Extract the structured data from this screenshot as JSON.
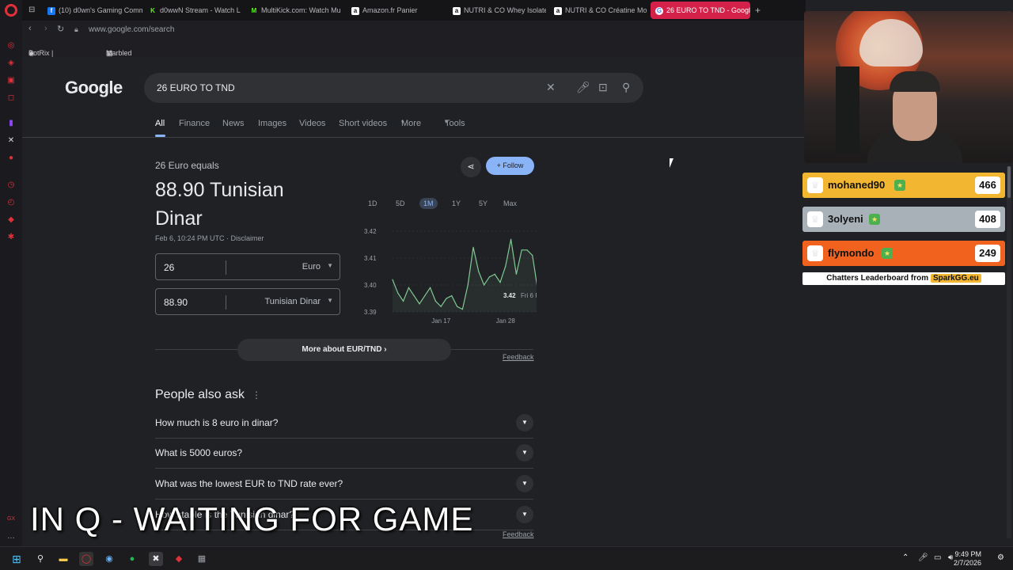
{
  "browser": {
    "tabs": [
      {
        "label": "(10) d0wn's Gaming Comm",
        "favicon": "facebook-icon",
        "color": "#1877f2"
      },
      {
        "label": "d0wwN Stream - Watch L",
        "favicon": "kick-icon",
        "color": "#53fc18"
      },
      {
        "label": "MultiKick.com: Watch Mu",
        "favicon": "multikick-icon",
        "color": "#53fc18"
      },
      {
        "label": "Amazon.fr Panier",
        "favicon": "amazon-icon",
        "color": "#ffffff"
      },
      {
        "label": "NUTRI & CO Whey Isolate",
        "favicon": "amazon-icon",
        "color": "#ffffff"
      },
      {
        "label": "NUTRI & CO Créatine Mo",
        "favicon": "amazon-icon",
        "color": "#ffffff"
      },
      {
        "label": "26 EURO TO TND - Googl",
        "favicon": "google-icon",
        "color": "#ffffff"
      }
    ],
    "url": "www.google.com/search",
    "bookmarks": [
      "BotRix | Giveaways",
      "Marbled Dashboar..."
    ]
  },
  "google": {
    "logo": "Google",
    "query": "26 EURO TO TND",
    "tabs": [
      "All",
      "Finance",
      "News",
      "Images",
      "Videos",
      "Short videos",
      "More",
      "Tools"
    ],
    "equals_text": "26 Euro equals",
    "result_line1": "88.90 Tunisian",
    "result_line2": "Dinar",
    "timestamp": "Feb 6, 10:24 PM UTC",
    "disclaimer": "Disclaimer",
    "from_value": "26",
    "from_currency": "Euro",
    "to_value": "88.90",
    "to_currency": "Tunisian Dinar",
    "follow_label": "Follow",
    "ranges": [
      "1D",
      "5D",
      "1M",
      "1Y",
      "5Y",
      "Max"
    ],
    "selected_range": "1M",
    "more_about": "More about EUR/TND",
    "feedback": "Feedback",
    "paa_title": "People also ask",
    "paa": [
      "How much is 8 euro in dinar?",
      "What is 5000 euros?",
      "What was the lowest EUR to TND rate ever?",
      "How stable is the Tunisian dinar?"
    ]
  },
  "chart_data": {
    "type": "line",
    "y_ticks": [
      "3.42",
      "3.41",
      "3.40",
      "3.39"
    ],
    "ylim": [
      3.39,
      3.42
    ],
    "x_ticks": [
      "Jan 17",
      "Jan 28"
    ],
    "values": [
      3.402,
      3.397,
      3.394,
      3.399,
      3.396,
      3.393,
      3.396,
      3.399,
      3.394,
      3.392,
      3.395,
      3.396,
      3.392,
      3.391,
      3.4,
      3.414,
      3.405,
      3.4,
      3.403,
      3.404,
      3.401,
      3.407,
      3.417,
      3.404,
      3.413,
      3.413,
      3.411,
      3.398,
      3.409,
      3.417,
      3.42
    ],
    "tooltip_value": "3.42",
    "tooltip_date": "Fri 6 Feb",
    "color": "#81c995"
  },
  "stream": {
    "overlay_text": "IN Q - WAITING FOR GAME",
    "leaderboard": [
      {
        "name": "mohaned90",
        "score": "466",
        "color": "#f2b630"
      },
      {
        "name": "3olyeni",
        "score": "408",
        "color": "#a9b1b8"
      },
      {
        "name": "flymondo",
        "score": "249",
        "color": "#f0621e"
      }
    ],
    "leaderboard_footer": "Chatters Leaderboard from",
    "leaderboard_brand": "SparkGG.eu"
  },
  "taskbar": {
    "time": "9:49 PM",
    "date": "2/7/2026"
  }
}
